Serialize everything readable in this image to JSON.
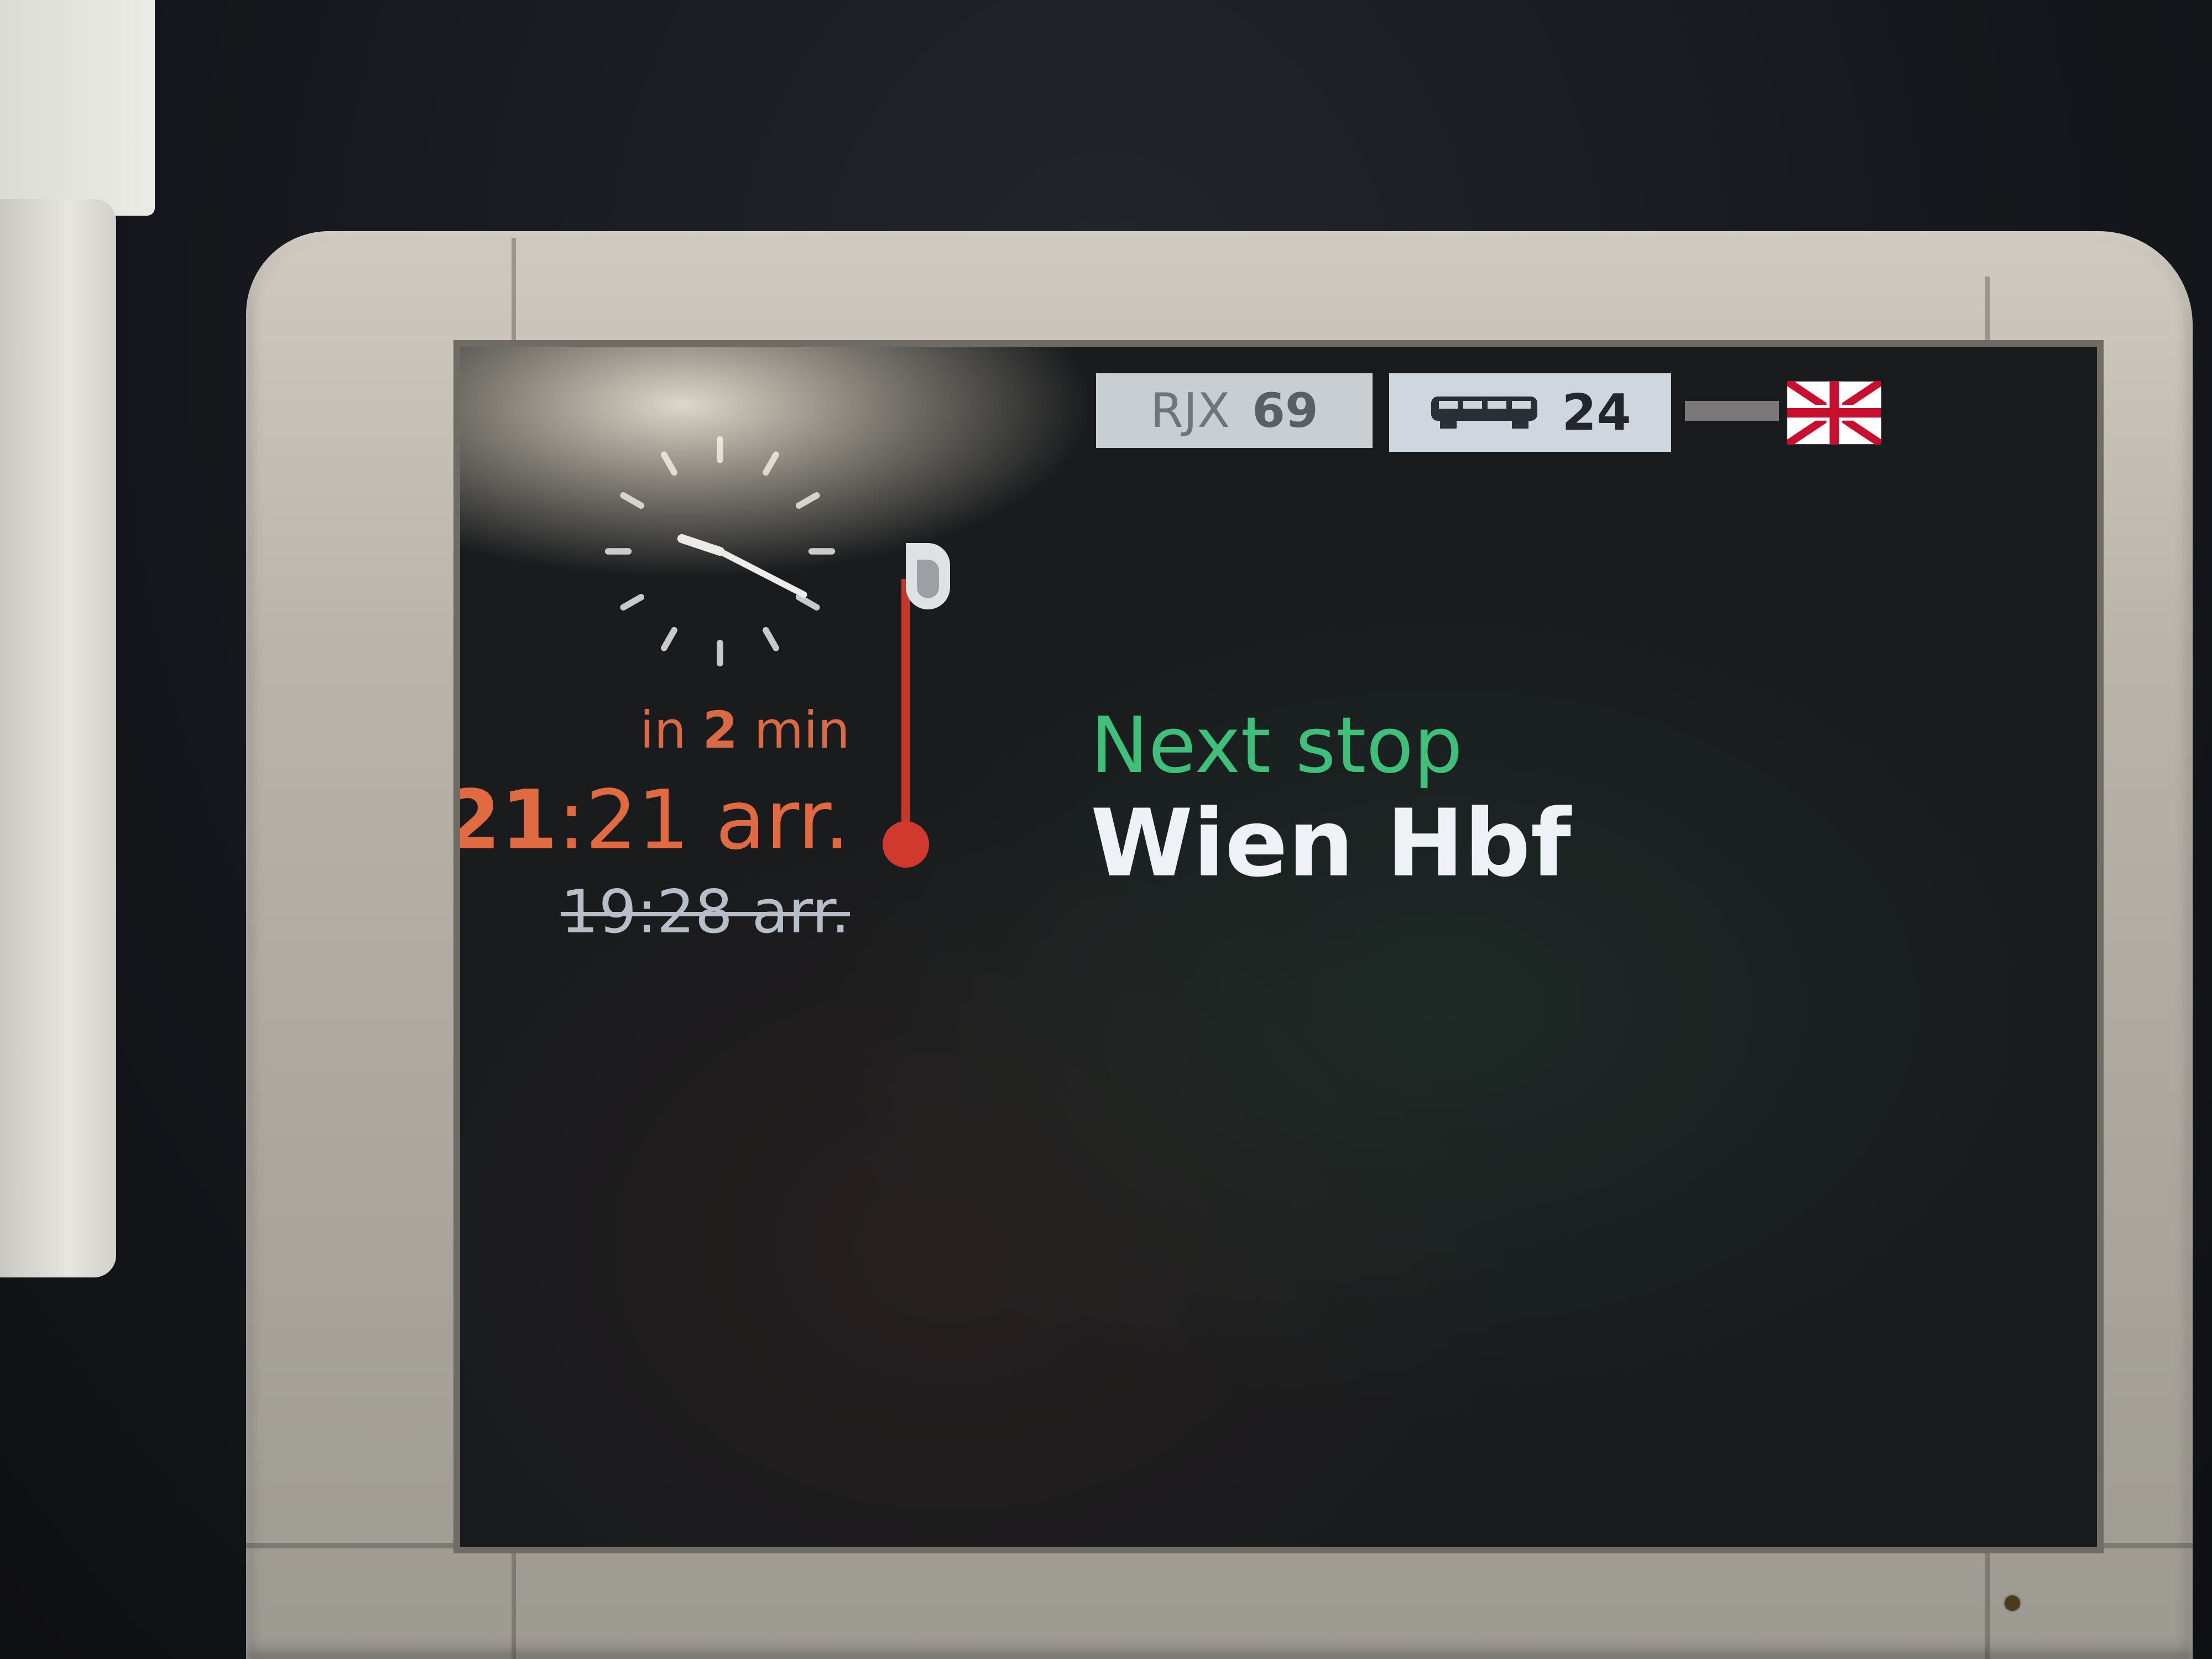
{
  "header": {
    "train_prefix": "RJX",
    "train_number": "69",
    "coach_number": "24",
    "coach_icon": "railcar-icon",
    "language_flag": "uk-flag-icon"
  },
  "arrival": {
    "countdown_prefix": "in",
    "countdown_value": "2",
    "countdown_unit": "min",
    "hours": "21",
    "rest": ":21 arr.",
    "scheduled": "19:28 arr."
  },
  "next_stop": {
    "label": "Next stop",
    "station": "Wien Hbf"
  },
  "colors": {
    "accent_delay": "#e06a42",
    "next_stop_green": "#3fbf7a",
    "timeline_red": "#c0392b"
  }
}
